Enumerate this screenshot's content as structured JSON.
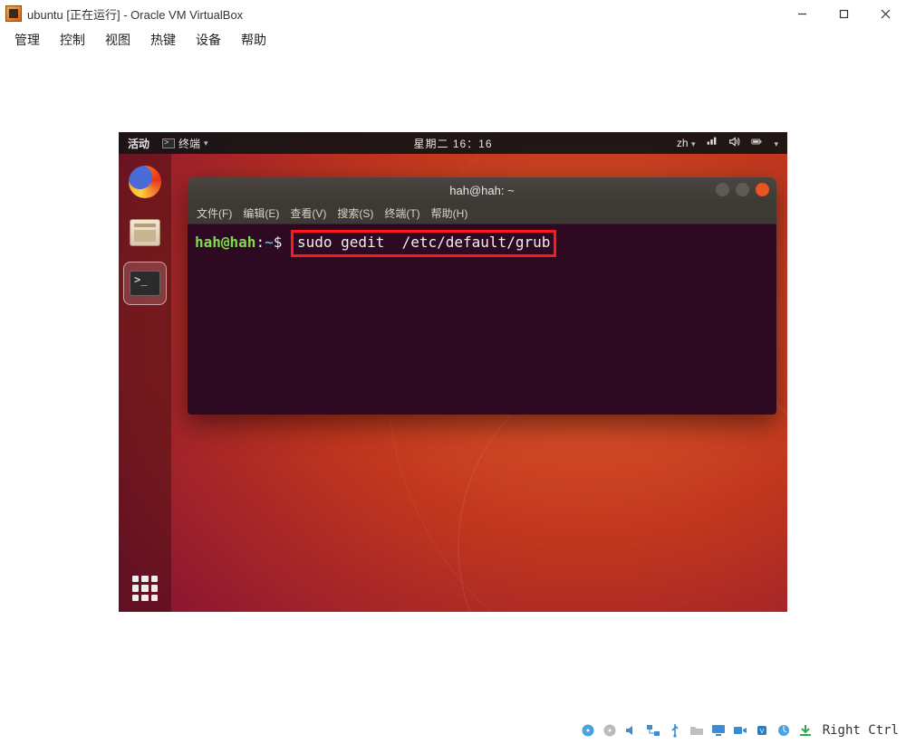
{
  "vbox": {
    "title": "ubuntu [正在运行] - Oracle VM VirtualBox",
    "menu": [
      "管理",
      "控制",
      "视图",
      "热键",
      "设备",
      "帮助"
    ],
    "status": {
      "hostkey": "Right Ctrl",
      "icons": [
        "harddisk-icon",
        "optical-icon",
        "audio-icon",
        "network-icon",
        "usb-icon",
        "shared-folder-icon",
        "display-icon",
        "recording-icon",
        "cpu-icon",
        "mouse-capture-icon",
        "keyboard-capture-icon"
      ]
    }
  },
  "gnome": {
    "activities": "活动",
    "app_label": "终端",
    "clock": "星期二 16：16",
    "ime": "zh",
    "tray": [
      "network-icon",
      "volume-icon",
      "battery-icon",
      "power-icon"
    ]
  },
  "dock": {
    "items": [
      {
        "name": "firefox",
        "active": false
      },
      {
        "name": "files",
        "active": false
      },
      {
        "name": "terminal",
        "active": true
      }
    ]
  },
  "terminal": {
    "title": "hah@hah: ~",
    "menu": [
      "文件(F)",
      "编辑(E)",
      "查看(V)",
      "搜索(S)",
      "终端(T)",
      "帮助(H)"
    ],
    "prompt": {
      "user": "hah@hah",
      "sep1": ":",
      "path": "~",
      "sigil": "$"
    },
    "command": "sudo gedit  /etc/default/grub"
  }
}
